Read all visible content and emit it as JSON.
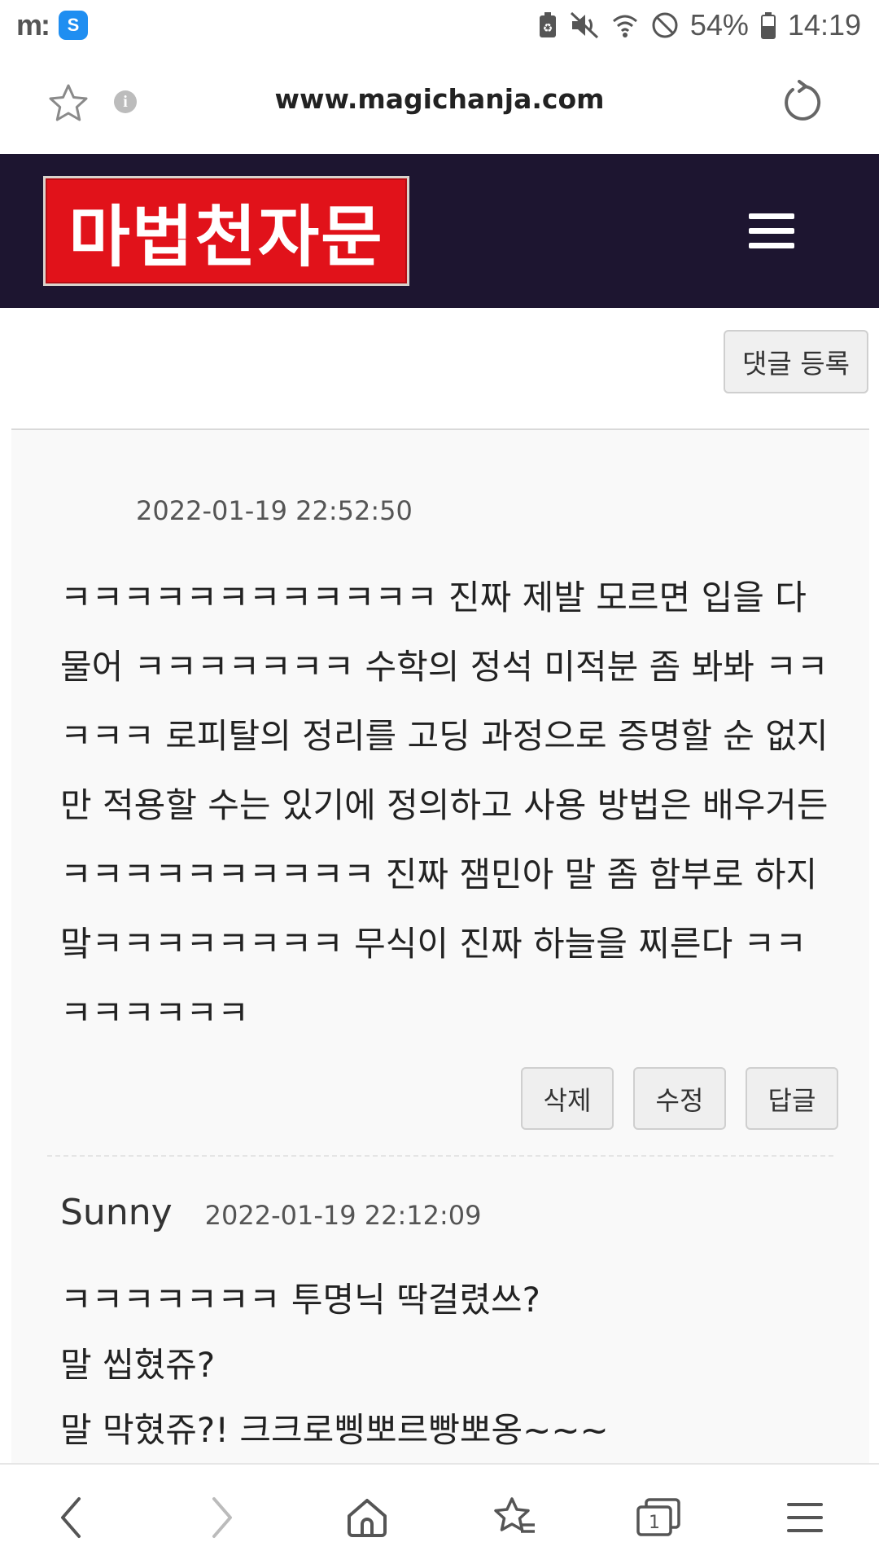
{
  "status_bar": {
    "left_icons": [
      "m-app-icon",
      "s-app-icon"
    ],
    "battery": "54%",
    "time": "14:19",
    "icons": [
      "battery-saver-icon",
      "mute-icon",
      "wifi-icon",
      "do-not-disturb-icon",
      "battery-icon"
    ]
  },
  "browser": {
    "url": "www.magichanja.com"
  },
  "site": {
    "logo_text": "마법천자문"
  },
  "buttons": {
    "register_comment": "댓글 등록",
    "delete": "삭제",
    "edit": "수정",
    "reply": "답글"
  },
  "comments": [
    {
      "author": "",
      "date": "2022-01-19 22:52:50",
      "body": "ㅋㅋㅋㅋㅋㅋㅋㅋㅋㅋㅋㅋ 진짜 제발 모르면 입을 다물어 ㅋㅋㅋㅋㅋㅋㅋ 수학의 정석 미적분 좀 봐봐 ㅋㅋㅋㅋㅋ 로피탈의 정리를 고딩 과정으로 증명할 순 없지만 적용할 수는 있기에 정의하고 사용 방법은 배우거든 ㅋㅋㅋㅋㅋㅋㅋㅋㅋㅋ 진짜 잼민아 말 좀 함부로 하지 맠ㅋㅋㅋㅋㅋㅋㅋㅋ 무식이 진짜 하늘을 찌른다 ㅋㅋㅋㅋㅋㅋㅋㅋ"
    },
    {
      "author": "Sunny",
      "date": "2022-01-19 22:12:09",
      "body": "ㅋㅋㅋㅋㅋㅋㅋ 투명닉 딱걸렸쓰?\n말 씹혔쥬?\n말 막혔쥬?! 크크로삥뽀르빵뽀옹~~~"
    }
  ],
  "bottom_nav": {
    "tab_count": "1",
    "items": [
      "back-icon",
      "forward-icon",
      "home-icon",
      "bookmarks-icon",
      "tabs-icon",
      "menu-icon"
    ]
  }
}
